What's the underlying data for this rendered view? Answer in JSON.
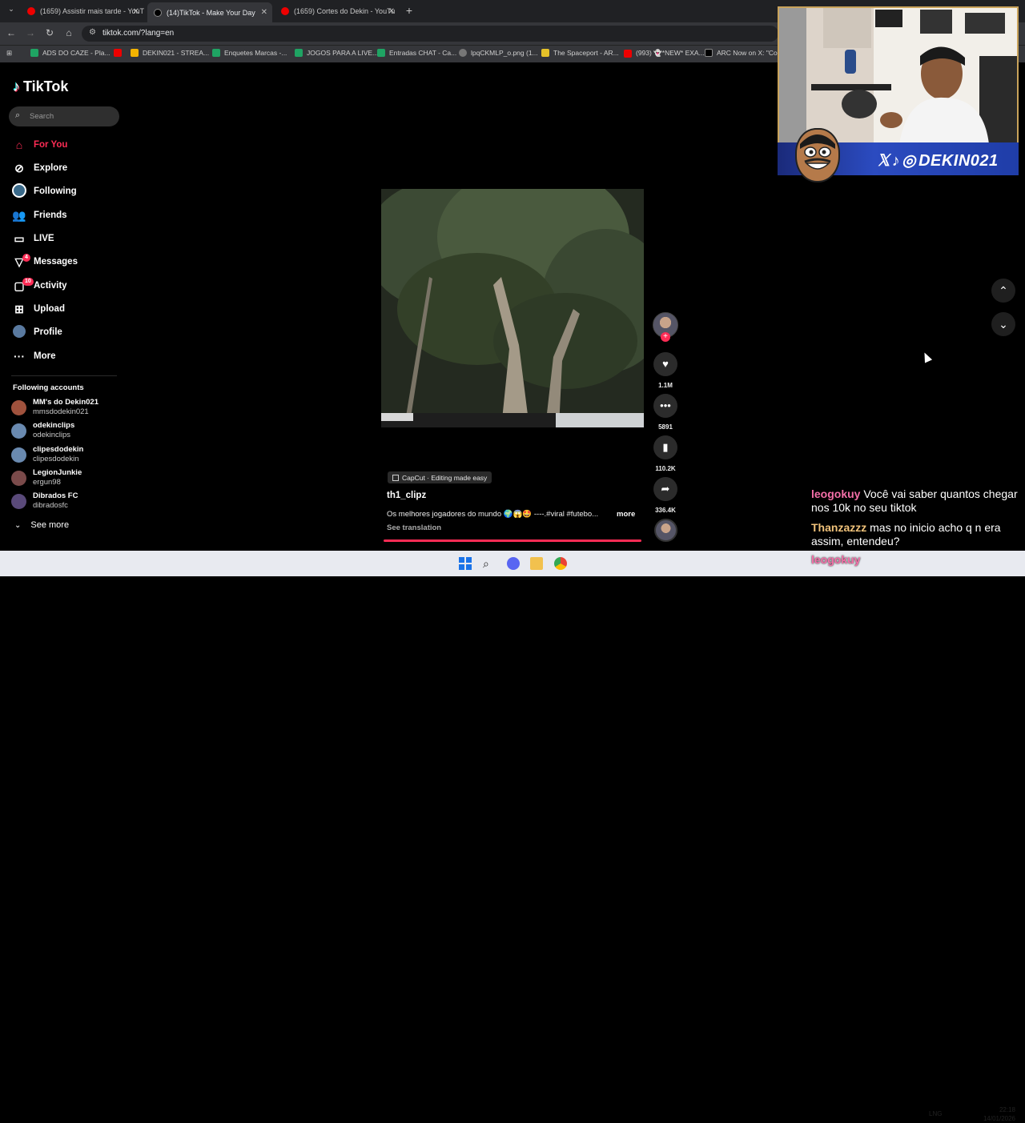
{
  "browser": {
    "tabs": [
      {
        "title": "(1659) Assistir mais tarde - YouT",
        "icon": "youtube-icon"
      },
      {
        "title": "(14)TikTok - Make Your Day",
        "icon": "tiktok-icon"
      },
      {
        "title": "(1659) Cortes do Dekin - YouTu",
        "icon": "youtube-icon"
      }
    ],
    "new_tab_label": "+",
    "url": "tiktok.com/?lang=en",
    "bookmarks": [
      "ADS DO CAZE - Pla...",
      "DEKIN021 - STREA...",
      "Enquetes Marcas -...",
      "JOGOS PARA A LIVE...",
      "Entradas CHAT - Ca...",
      "lpqCKMLP_o.png (1...",
      "The Spaceport - AR...",
      "(993) 👻*NEW* EXA...",
      "ARC Now on X: \"Co..."
    ]
  },
  "tiktok": {
    "logo": "TikTok",
    "search_placeholder": "Search",
    "nav": [
      {
        "label": "For You",
        "icon": "home-icon"
      },
      {
        "label": "Explore",
        "icon": "compass-icon"
      },
      {
        "label": "Following",
        "icon": "following-avatar-icon"
      },
      {
        "label": "Friends",
        "icon": "friends-icon"
      },
      {
        "label": "LIVE",
        "icon": "live-icon"
      },
      {
        "label": "Messages",
        "icon": "messages-icon",
        "badge": "4"
      },
      {
        "label": "Activity",
        "icon": "activity-icon",
        "badge": "10"
      },
      {
        "label": "Upload",
        "icon": "upload-icon"
      },
      {
        "label": "Profile",
        "icon": "profile-icon"
      },
      {
        "label": "More",
        "icon": "more-icon"
      }
    ],
    "following_title": "Following accounts",
    "accounts": [
      {
        "name": "MM's do Dekin021",
        "handle": "mmsdodekin021"
      },
      {
        "name": "odekinclips",
        "handle": "odekinclips"
      },
      {
        "name": "clipesdodekin",
        "handle": "clipesdodekin"
      },
      {
        "name": "LegionJunkie",
        "handle": "ergun98"
      },
      {
        "name": "Dibrados FC",
        "handle": "dibradosfc"
      }
    ],
    "see_more": "See more",
    "video": {
      "capcut_label": "CapCut · Editing made easy",
      "author": "th1_clipz",
      "caption": "Os melhores jogadores do mundo 🌍😱🤩 ----.#viral #futebo...",
      "more": "more",
      "see_translation": "See translation",
      "likes": "1.1M",
      "comments": "5891",
      "saves": "110.2K",
      "shares": "336.4K"
    }
  },
  "overlay": {
    "brand": "DEKIN021",
    "chat": [
      {
        "user": "leogokuy",
        "message": "Você vai saber quantos chegar nos 10k no seu tiktok"
      },
      {
        "user": "Thanzazzz",
        "message": "mas no inicio acho q n era assim, entendeu?"
      },
      {
        "user": "leogokuy",
        "message": ""
      }
    ]
  },
  "taskbar": {
    "lang": "LNG",
    "time": "22:18",
    "date": "14/01/2026"
  },
  "colors": {
    "accent": "#fe2c55",
    "chrome_dark": "#202124",
    "chrome_toolbar": "#35363a"
  }
}
